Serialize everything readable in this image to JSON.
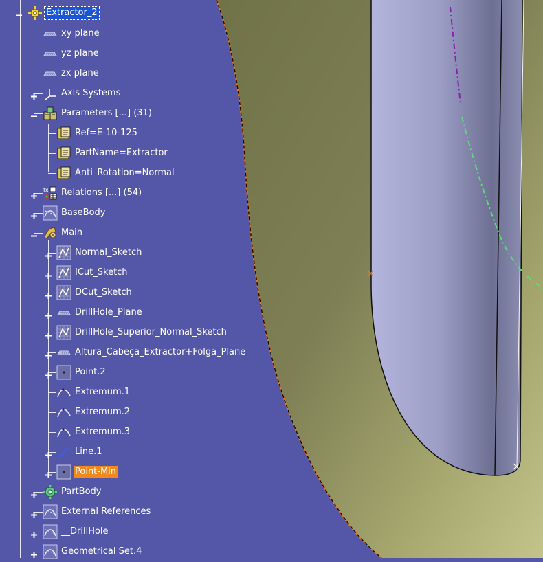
{
  "tree": {
    "root": {
      "label": "Extractor_2",
      "icon": "gear-icon"
    },
    "items": [
      {
        "label": "xy plane",
        "icon": "plane-icon"
      },
      {
        "label": "yz plane",
        "icon": "plane-icon"
      },
      {
        "label": "zx plane",
        "icon": "plane-icon"
      },
      {
        "label": "Axis Systems",
        "icon": "axis-system-icon"
      },
      {
        "label": "Parameters [...] (31)",
        "icon": "parameters-icon"
      },
      {
        "label": "Ref=E-10-125",
        "icon": "parameter-string-icon"
      },
      {
        "label": "PartName=Extractor",
        "icon": "parameter-string-icon"
      },
      {
        "label": "Anti_Rotation=Normal",
        "icon": "parameter-string-icon"
      },
      {
        "label": "Relations [...] (54)",
        "icon": "relations-icon"
      },
      {
        "label": "BaseBody",
        "icon": "geometrical-set-icon"
      },
      {
        "label": "Main",
        "icon": "hybrid-body-icon"
      },
      {
        "label": "Normal_Sketch",
        "icon": "sketch-icon"
      },
      {
        "label": "ICut_Sketch",
        "icon": "sketch-icon"
      },
      {
        "label": "DCut_Sketch",
        "icon": "sketch-icon"
      },
      {
        "label": "DrillHole_Plane",
        "icon": "plane-icon"
      },
      {
        "label": "DrillHole_Superior_Normal_Sketch",
        "icon": "sketch-icon"
      },
      {
        "label": "Altura_Cabeça_Extractor+Folga_Plane",
        "icon": "plane-icon"
      },
      {
        "label": "Point.2",
        "icon": "point-icon"
      },
      {
        "label": "Extremum.1",
        "icon": "extremum-icon"
      },
      {
        "label": "Extremum.2",
        "icon": "extremum-icon"
      },
      {
        "label": "Extremum.3",
        "icon": "extremum-icon"
      },
      {
        "label": "Line.1",
        "icon": "line-icon"
      },
      {
        "label": "Point-Min",
        "icon": "point-icon"
      },
      {
        "label": "PartBody",
        "icon": "part-body-icon"
      },
      {
        "label": "External References",
        "icon": "geometrical-set-icon"
      },
      {
        "label": "__DrillHole",
        "icon": "geometrical-set-icon"
      },
      {
        "label": "Geometrical Set.4",
        "icon": "geometrical-set-icon"
      }
    ]
  },
  "colors": {
    "background": "#5457a8",
    "surface": "#7d7f56",
    "cylinder": "#a4a6cc",
    "selected": "#1a55d4",
    "highlight": "#f2891d",
    "edge_orange": "#e87b1c"
  }
}
